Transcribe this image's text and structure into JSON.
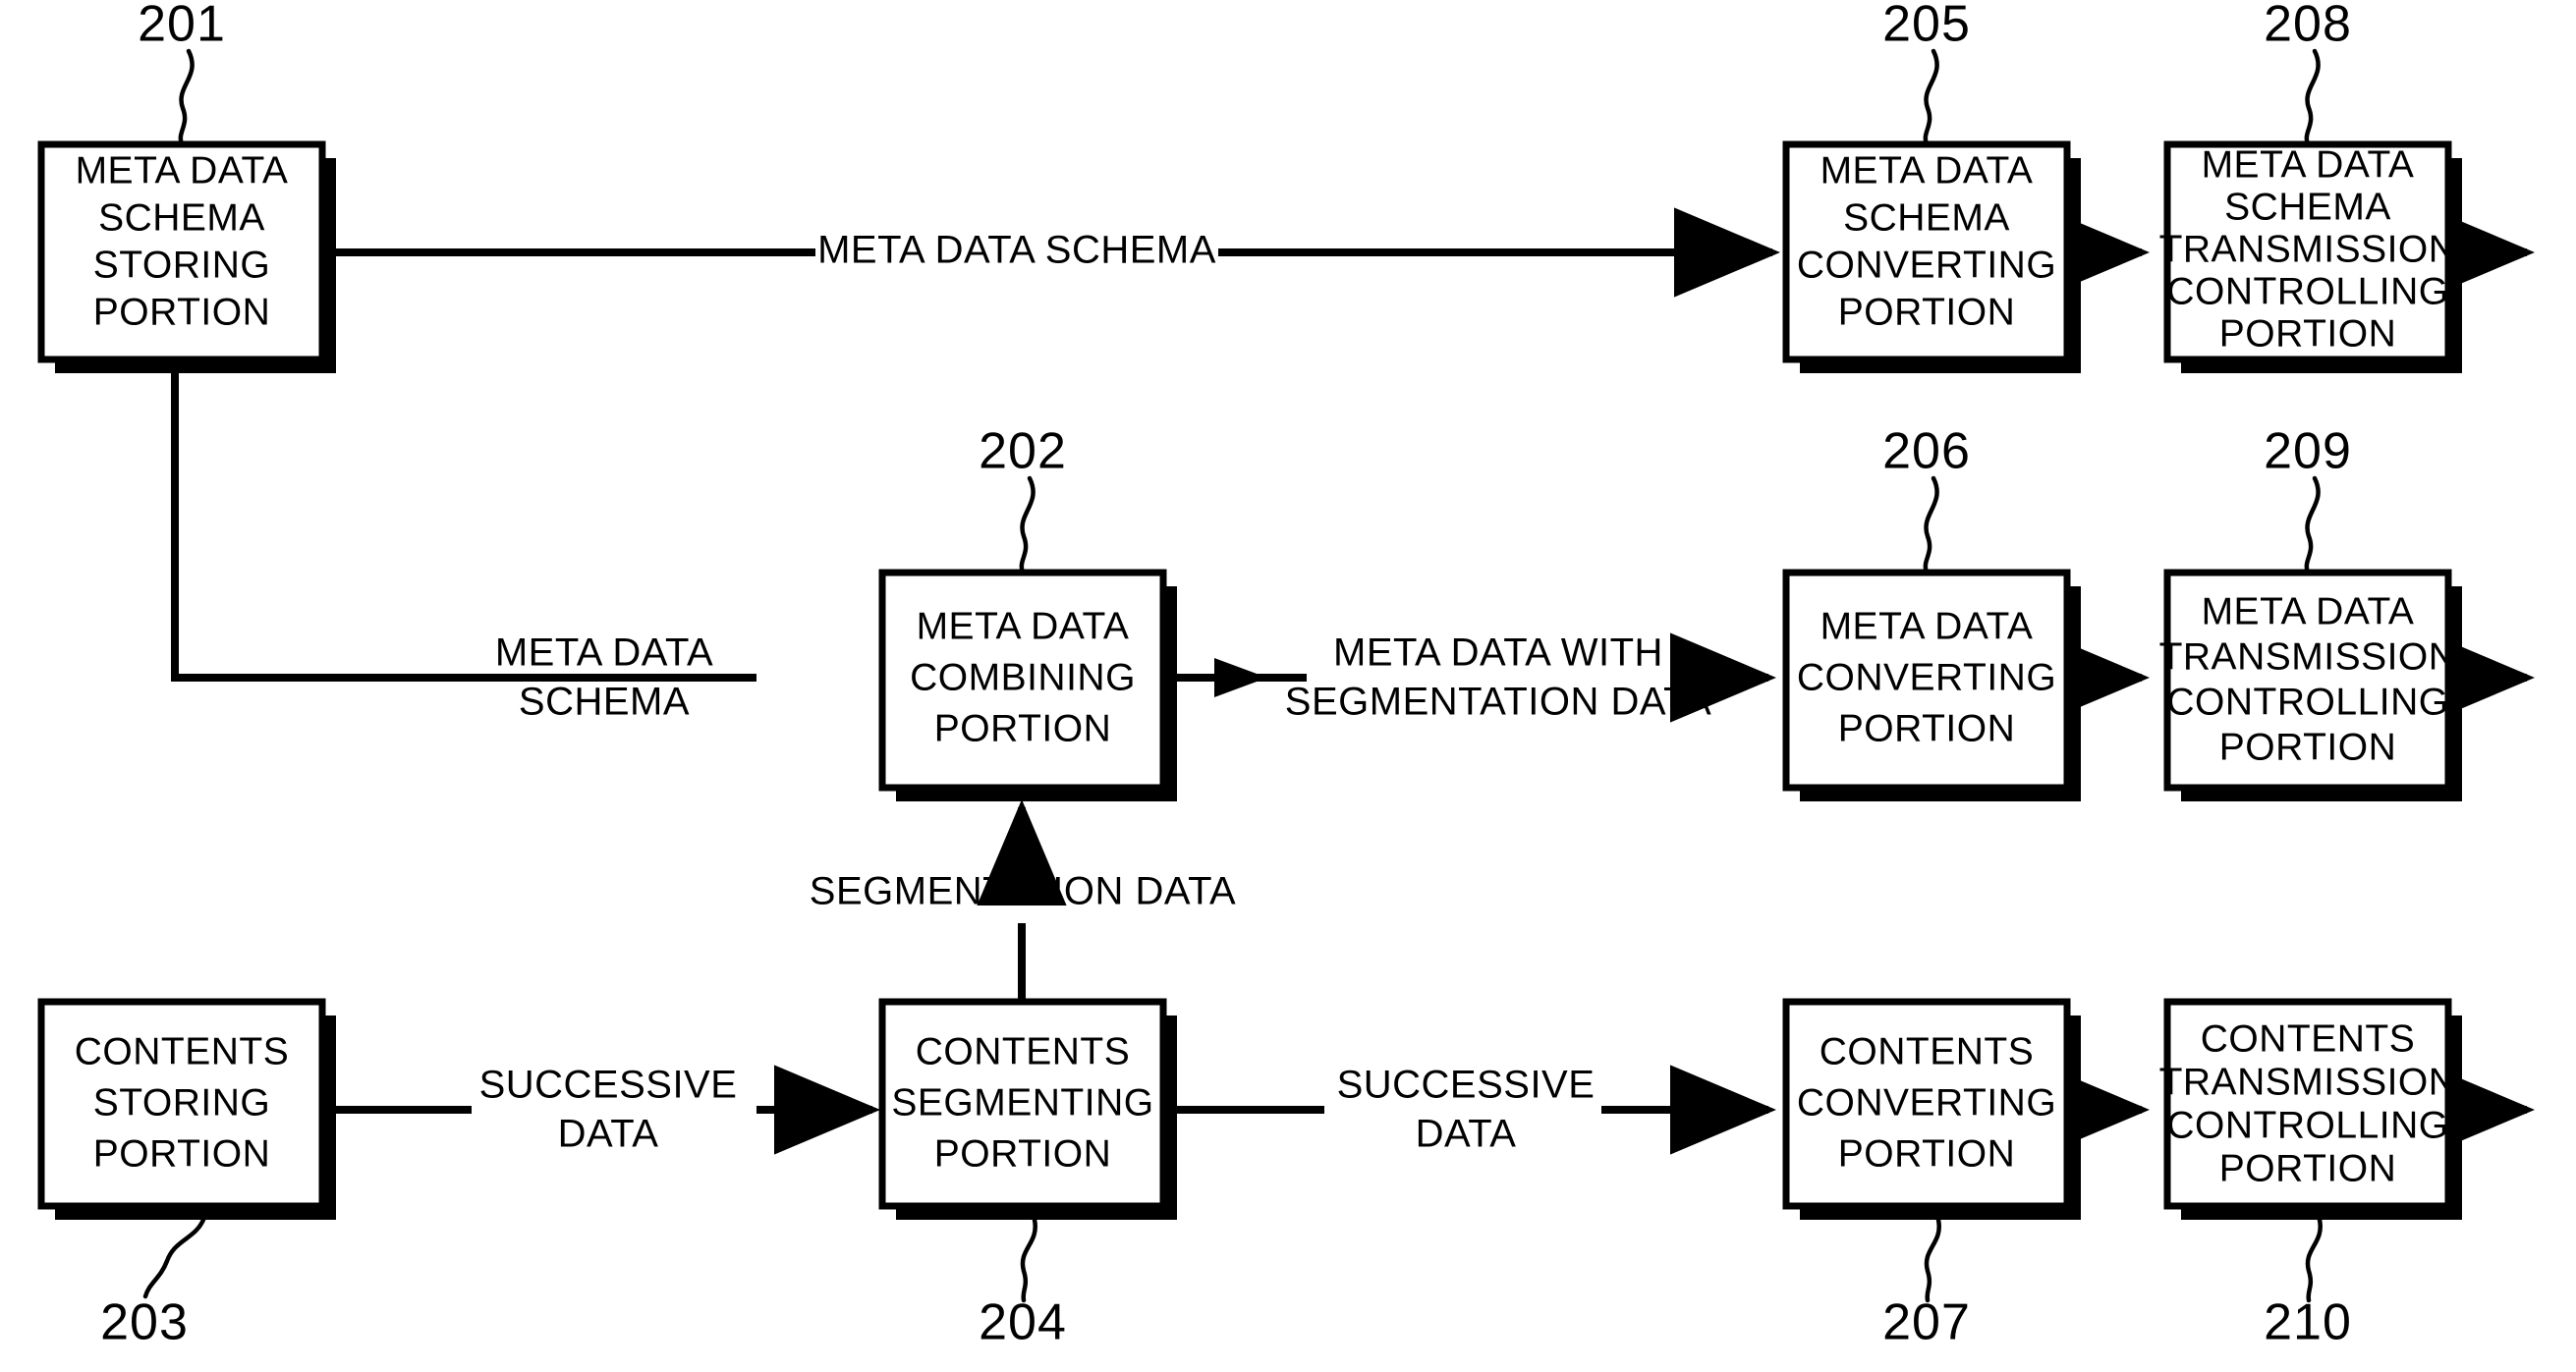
{
  "figure": {
    "type": "patent-block-diagram",
    "background_color": "#ffffff",
    "line_color": "#000000"
  },
  "blocks": [
    {
      "id": "201",
      "ref": "201",
      "lines": [
        "META DATA",
        "SCHEMA",
        "STORING",
        "PORTION"
      ],
      "row": "top",
      "column": 1
    },
    {
      "id": "205",
      "ref": "205",
      "lines": [
        "META DATA",
        "SCHEMA",
        "CONVERTING",
        "PORTION"
      ],
      "row": "top",
      "column": 4
    },
    {
      "id": "208",
      "ref": "208",
      "lines": [
        "META DATA",
        "SCHEMA",
        "TRANSMISSION",
        "CONTROLLING",
        "PORTION"
      ],
      "row": "top",
      "column": 5
    },
    {
      "id": "202",
      "ref": "202",
      "lines": [
        "META DATA",
        "COMBINING",
        "PORTION"
      ],
      "row": "middle",
      "column": 3
    },
    {
      "id": "206",
      "ref": "206",
      "lines": [
        "META DATA",
        "CONVERTING",
        "PORTION"
      ],
      "row": "middle",
      "column": 4
    },
    {
      "id": "209",
      "ref": "209",
      "lines": [
        "META DATA",
        "TRANSMISSION",
        "CONTROLLING",
        "PORTION"
      ],
      "row": "middle",
      "column": 5
    },
    {
      "id": "203",
      "ref": "203",
      "lines": [
        "CONTENTS",
        "STORING",
        "PORTION"
      ],
      "row": "bottom",
      "column": 1
    },
    {
      "id": "204",
      "ref": "204",
      "lines": [
        "CONTENTS",
        "SEGMENTING",
        "PORTION"
      ],
      "row": "bottom",
      "column": 3
    },
    {
      "id": "207",
      "ref": "207",
      "lines": [
        "CONTENTS",
        "CONVERTING",
        "PORTION"
      ],
      "row": "bottom",
      "column": 4
    },
    {
      "id": "210",
      "ref": "210",
      "lines": [
        "CONTENTS",
        "TRANSMISSION",
        "CONTROLLING",
        "PORTION"
      ],
      "row": "bottom",
      "column": 5
    }
  ],
  "edge_labels": {
    "top_schema": "META DATA SCHEMA",
    "mid_schema_line1": "META DATA",
    "mid_schema_line2": "SCHEMA",
    "meta_with_seg_line1": "META DATA WITH",
    "meta_with_seg_line2": "SEGMENTATION DATA",
    "segmentation_data": "SEGMENTATION DATA",
    "successive_left_line1": "SUCCESSIVE",
    "successive_left_line2": "DATA",
    "successive_right_line1": "SUCCESSIVE",
    "successive_right_line2": "DATA"
  },
  "ref_numbers": {
    "n201": "201",
    "n202": "202",
    "n203": "203",
    "n204": "204",
    "n205": "205",
    "n206": "206",
    "n207": "207",
    "n208": "208",
    "n209": "209",
    "n210": "210"
  }
}
